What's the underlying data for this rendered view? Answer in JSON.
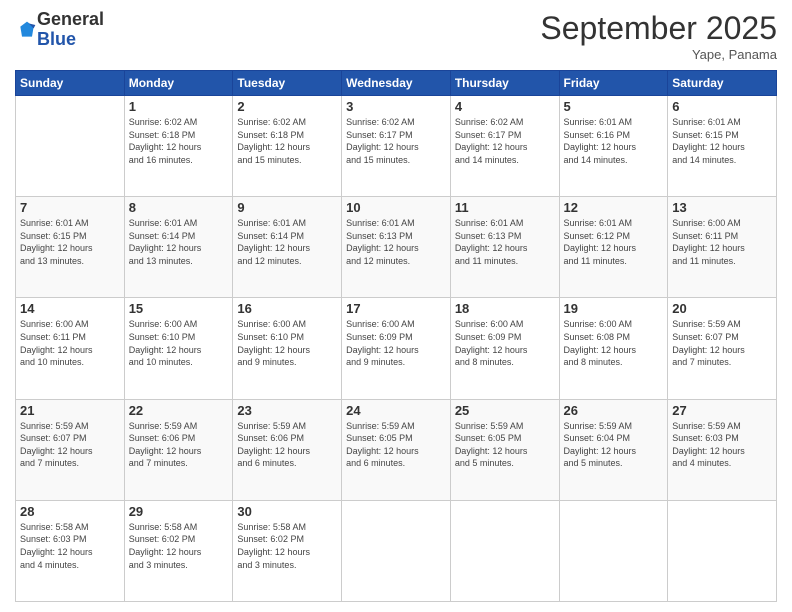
{
  "logo": {
    "general": "General",
    "blue": "Blue"
  },
  "header": {
    "month": "September 2025",
    "location": "Yape, Panama"
  },
  "weekdays": [
    "Sunday",
    "Monday",
    "Tuesday",
    "Wednesday",
    "Thursday",
    "Friday",
    "Saturday"
  ],
  "weeks": [
    [
      {
        "day": "",
        "info": ""
      },
      {
        "day": "1",
        "info": "Sunrise: 6:02 AM\nSunset: 6:18 PM\nDaylight: 12 hours\nand 16 minutes."
      },
      {
        "day": "2",
        "info": "Sunrise: 6:02 AM\nSunset: 6:18 PM\nDaylight: 12 hours\nand 15 minutes."
      },
      {
        "day": "3",
        "info": "Sunrise: 6:02 AM\nSunset: 6:17 PM\nDaylight: 12 hours\nand 15 minutes."
      },
      {
        "day": "4",
        "info": "Sunrise: 6:02 AM\nSunset: 6:17 PM\nDaylight: 12 hours\nand 14 minutes."
      },
      {
        "day": "5",
        "info": "Sunrise: 6:01 AM\nSunset: 6:16 PM\nDaylight: 12 hours\nand 14 minutes."
      },
      {
        "day": "6",
        "info": "Sunrise: 6:01 AM\nSunset: 6:15 PM\nDaylight: 12 hours\nand 14 minutes."
      }
    ],
    [
      {
        "day": "7",
        "info": "Sunrise: 6:01 AM\nSunset: 6:15 PM\nDaylight: 12 hours\nand 13 minutes."
      },
      {
        "day": "8",
        "info": "Sunrise: 6:01 AM\nSunset: 6:14 PM\nDaylight: 12 hours\nand 13 minutes."
      },
      {
        "day": "9",
        "info": "Sunrise: 6:01 AM\nSunset: 6:14 PM\nDaylight: 12 hours\nand 12 minutes."
      },
      {
        "day": "10",
        "info": "Sunrise: 6:01 AM\nSunset: 6:13 PM\nDaylight: 12 hours\nand 12 minutes."
      },
      {
        "day": "11",
        "info": "Sunrise: 6:01 AM\nSunset: 6:13 PM\nDaylight: 12 hours\nand 11 minutes."
      },
      {
        "day": "12",
        "info": "Sunrise: 6:01 AM\nSunset: 6:12 PM\nDaylight: 12 hours\nand 11 minutes."
      },
      {
        "day": "13",
        "info": "Sunrise: 6:00 AM\nSunset: 6:11 PM\nDaylight: 12 hours\nand 11 minutes."
      }
    ],
    [
      {
        "day": "14",
        "info": "Sunrise: 6:00 AM\nSunset: 6:11 PM\nDaylight: 12 hours\nand 10 minutes."
      },
      {
        "day": "15",
        "info": "Sunrise: 6:00 AM\nSunset: 6:10 PM\nDaylight: 12 hours\nand 10 minutes."
      },
      {
        "day": "16",
        "info": "Sunrise: 6:00 AM\nSunset: 6:10 PM\nDaylight: 12 hours\nand 9 minutes."
      },
      {
        "day": "17",
        "info": "Sunrise: 6:00 AM\nSunset: 6:09 PM\nDaylight: 12 hours\nand 9 minutes."
      },
      {
        "day": "18",
        "info": "Sunrise: 6:00 AM\nSunset: 6:09 PM\nDaylight: 12 hours\nand 8 minutes."
      },
      {
        "day": "19",
        "info": "Sunrise: 6:00 AM\nSunset: 6:08 PM\nDaylight: 12 hours\nand 8 minutes."
      },
      {
        "day": "20",
        "info": "Sunrise: 5:59 AM\nSunset: 6:07 PM\nDaylight: 12 hours\nand 7 minutes."
      }
    ],
    [
      {
        "day": "21",
        "info": "Sunrise: 5:59 AM\nSunset: 6:07 PM\nDaylight: 12 hours\nand 7 minutes."
      },
      {
        "day": "22",
        "info": "Sunrise: 5:59 AM\nSunset: 6:06 PM\nDaylight: 12 hours\nand 7 minutes."
      },
      {
        "day": "23",
        "info": "Sunrise: 5:59 AM\nSunset: 6:06 PM\nDaylight: 12 hours\nand 6 minutes."
      },
      {
        "day": "24",
        "info": "Sunrise: 5:59 AM\nSunset: 6:05 PM\nDaylight: 12 hours\nand 6 minutes."
      },
      {
        "day": "25",
        "info": "Sunrise: 5:59 AM\nSunset: 6:05 PM\nDaylight: 12 hours\nand 5 minutes."
      },
      {
        "day": "26",
        "info": "Sunrise: 5:59 AM\nSunset: 6:04 PM\nDaylight: 12 hours\nand 5 minutes."
      },
      {
        "day": "27",
        "info": "Sunrise: 5:59 AM\nSunset: 6:03 PM\nDaylight: 12 hours\nand 4 minutes."
      }
    ],
    [
      {
        "day": "28",
        "info": "Sunrise: 5:58 AM\nSunset: 6:03 PM\nDaylight: 12 hours\nand 4 minutes."
      },
      {
        "day": "29",
        "info": "Sunrise: 5:58 AM\nSunset: 6:02 PM\nDaylight: 12 hours\nand 3 minutes."
      },
      {
        "day": "30",
        "info": "Sunrise: 5:58 AM\nSunset: 6:02 PM\nDaylight: 12 hours\nand 3 minutes."
      },
      {
        "day": "",
        "info": ""
      },
      {
        "day": "",
        "info": ""
      },
      {
        "day": "",
        "info": ""
      },
      {
        "day": "",
        "info": ""
      }
    ]
  ]
}
